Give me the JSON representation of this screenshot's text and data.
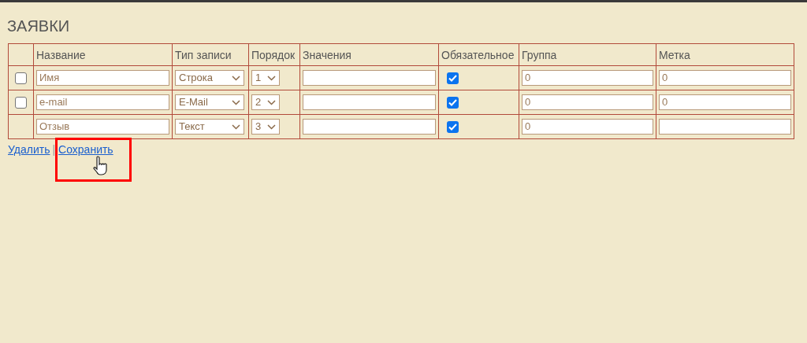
{
  "title": "ЗАЯВКИ",
  "table": {
    "columns": [
      "Название",
      "Тип записи",
      "Порядок",
      "Значения",
      "Обязательное",
      "Группа",
      "Метка"
    ],
    "rows": [
      {
        "select": {
          "checked": false
        },
        "name": "Имя",
        "type": "Строка",
        "order": "1",
        "values": "",
        "required": true,
        "group": "0",
        "mark": "0"
      },
      {
        "select": {
          "checked": false
        },
        "name": "e-mail",
        "type": "E-Mail",
        "order": "2",
        "values": "",
        "required": true,
        "group": "0",
        "mark": "0"
      },
      {
        "name": "Отзыв",
        "type": "Текст",
        "order": "3",
        "values": "",
        "required": true,
        "group": "0"
      }
    ]
  },
  "links": [
    {
      "label": "Удалить",
      "highlighted": false
    },
    {
      "label": "Сохранить",
      "highlighted": true
    }
  ],
  "separator": "|"
}
